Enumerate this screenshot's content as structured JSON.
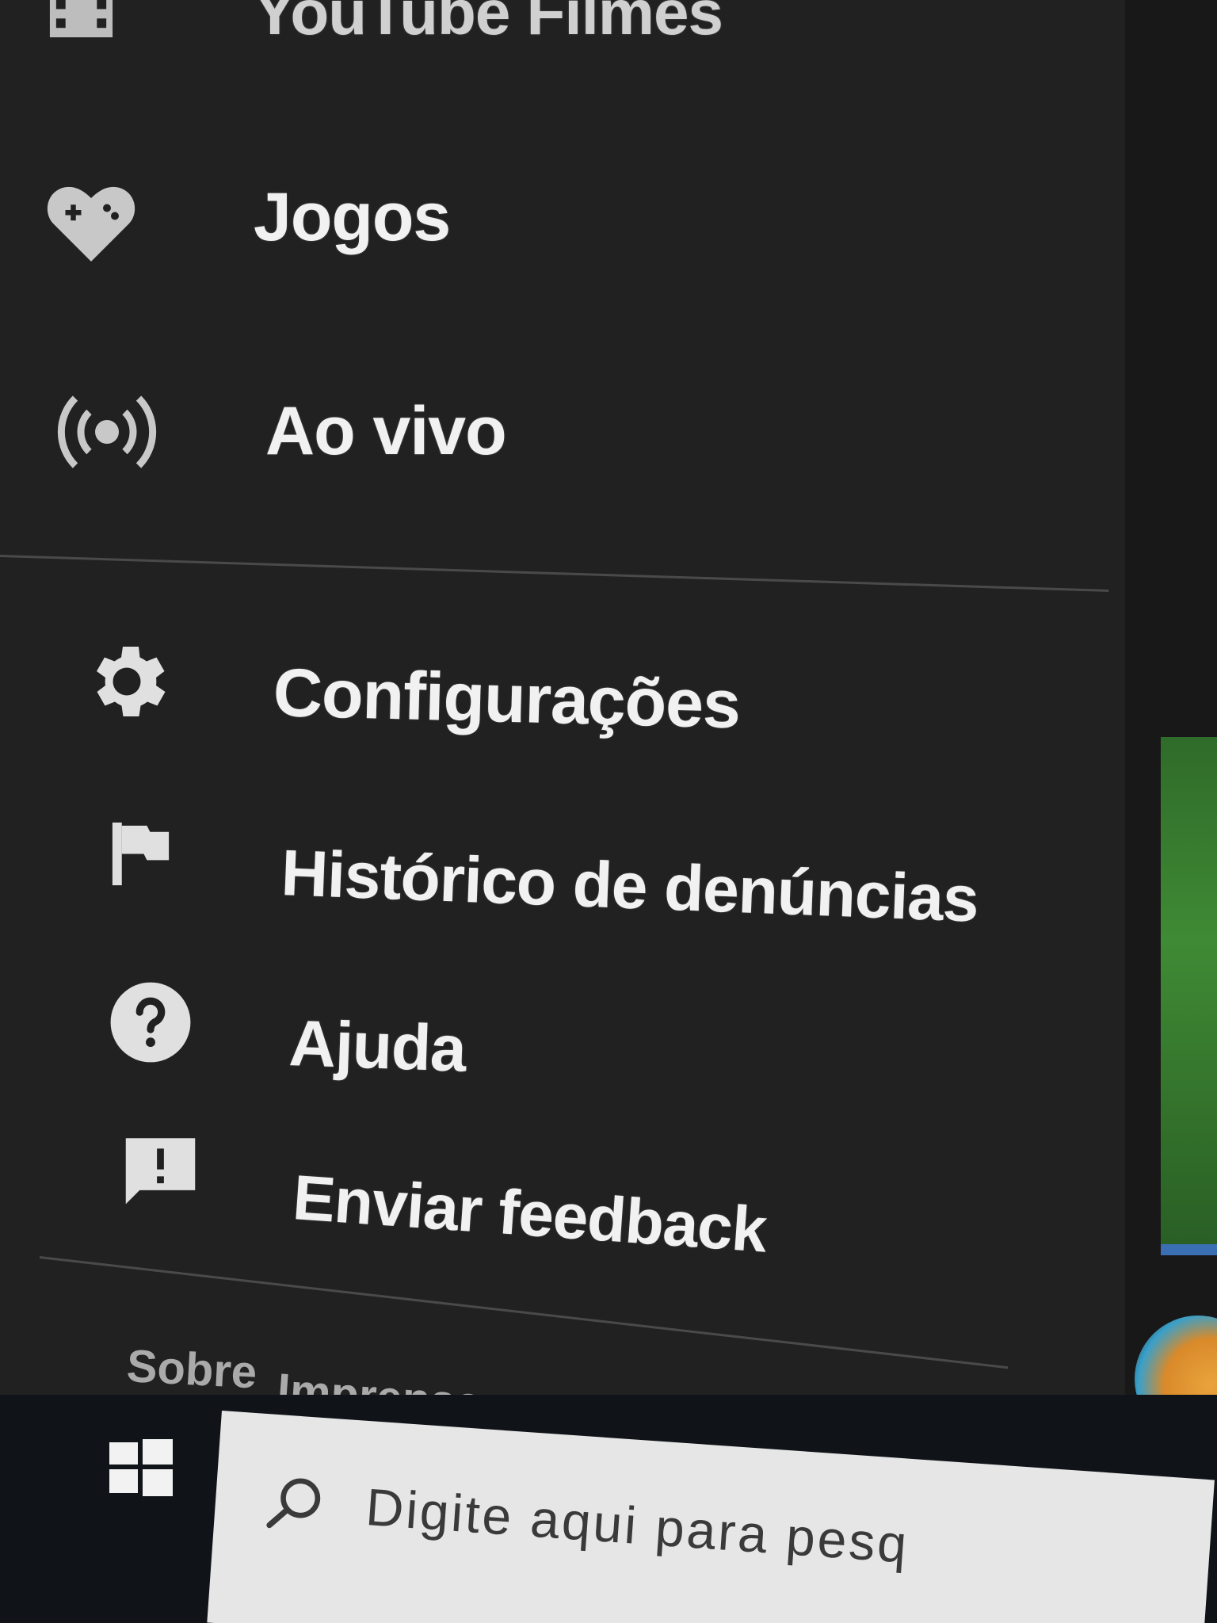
{
  "sidebar": {
    "partial_top_label": "YouTube Filmes",
    "items": [
      {
        "label": "Jogos",
        "icon": "gamepad-heart-icon"
      },
      {
        "label": "Ao vivo",
        "icon": "live-broadcast-icon"
      },
      {
        "label": "Configurações",
        "icon": "gear-icon"
      },
      {
        "label": "Histórico de denúncias",
        "icon": "flag-icon"
      },
      {
        "label": "Ajuda",
        "icon": "help-circle-icon"
      },
      {
        "label": "Enviar feedback",
        "icon": "feedback-icon"
      }
    ],
    "footer_links": [
      "Sobre",
      "Imprensa"
    ]
  },
  "taskbar": {
    "start_icon": "windows-logo-icon",
    "search_icon": "search-icon",
    "search_placeholder": "Digite aqui para pesq"
  },
  "colors": {
    "sidebar_bg": "#212121",
    "text": "#f1f1f1",
    "footer_text": "#aaaaaa",
    "divider": "#4a4a4a",
    "taskbar_bg": "#101418",
    "search_bg": "#e6e6e6"
  }
}
